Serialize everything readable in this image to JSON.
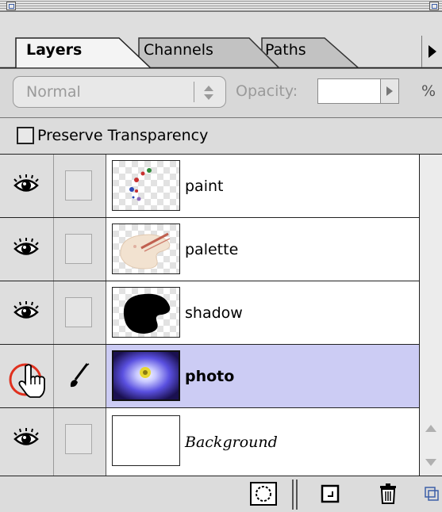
{
  "palette": {
    "tabs": [
      {
        "label": "Layers",
        "active": true
      },
      {
        "label": "Channels",
        "active": false
      },
      {
        "label": "Paths",
        "active": false
      }
    ],
    "blend_mode": {
      "value": "Normal",
      "enabled": false
    },
    "opacity": {
      "label": "Opacity:",
      "value": "",
      "unit": "%"
    },
    "preserve_transparency": {
      "label": "Preserve Transparency",
      "checked": false
    }
  },
  "layers": [
    {
      "name": "paint",
      "visible": true,
      "linked": false,
      "selected": false,
      "thumb": "paint-thumbnail"
    },
    {
      "name": "palette",
      "visible": true,
      "linked": false,
      "selected": false,
      "thumb": "palette-thumbnail"
    },
    {
      "name": "shadow",
      "visible": true,
      "linked": false,
      "selected": false,
      "thumb": "shadow-thumbnail"
    },
    {
      "name": "photo",
      "visible": false,
      "linked": false,
      "selected": true,
      "thumb": "photo-thumbnail",
      "brush_icon": "brush-icon"
    },
    {
      "name": "Background",
      "visible": true,
      "linked": false,
      "selected": false,
      "thumb": "background-thumbnail"
    }
  ],
  "cursor": {
    "icon": "hand-pointer-icon",
    "highlight": "red-circle-highlight"
  },
  "bottom_buttons": [
    {
      "icon": "quick-mask-icon"
    },
    {
      "icon": "new-layer-icon"
    },
    {
      "icon": "trash-icon"
    }
  ],
  "colors": {
    "selected_row": "#ccccf4",
    "highlight_circle": "#e0301e"
  }
}
